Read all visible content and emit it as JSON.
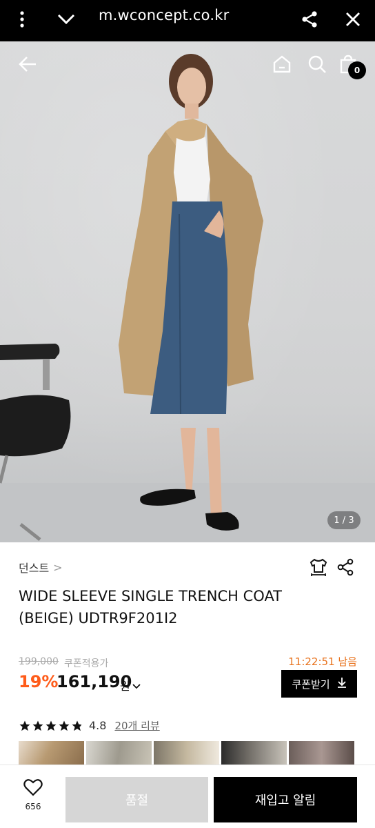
{
  "browser": {
    "url": "m.wconcept.co.kr",
    "icons": [
      "more-vertical-icon",
      "chevron-down-icon",
      "share-icon",
      "close-icon"
    ]
  },
  "product_nav": {
    "icons": [
      "back-arrow-icon",
      "home-icon",
      "search-icon",
      "shopping-bag-icon"
    ],
    "cart_count": "0"
  },
  "gallery": {
    "counter": "1 / 3"
  },
  "product": {
    "brand": "던스트",
    "brand_chevron": ">",
    "title_line1": "WIDE SLEEVE SINGLE TRENCH COAT",
    "title_line2": "(BEIGE) UDTR9F201I2",
    "original_price": "199,000",
    "coupon_note": "쿠폰적용가",
    "timer": "11:22:51 남음",
    "discount": "19%",
    "price": "161,190",
    "currency": "원",
    "coupon_button": "쿠폰받기",
    "rating": 4.8,
    "rating_text": "4.8",
    "reviews": "20개 리뷰"
  },
  "bottom_bar": {
    "wish_count": "656",
    "soldout_label": "품절",
    "restock_label": "재입고 알림"
  },
  "colors": {
    "accent": "#ff5c1a",
    "timer": "#e8711b",
    "black": "#000000",
    "disabled": "#d6d6d6"
  }
}
